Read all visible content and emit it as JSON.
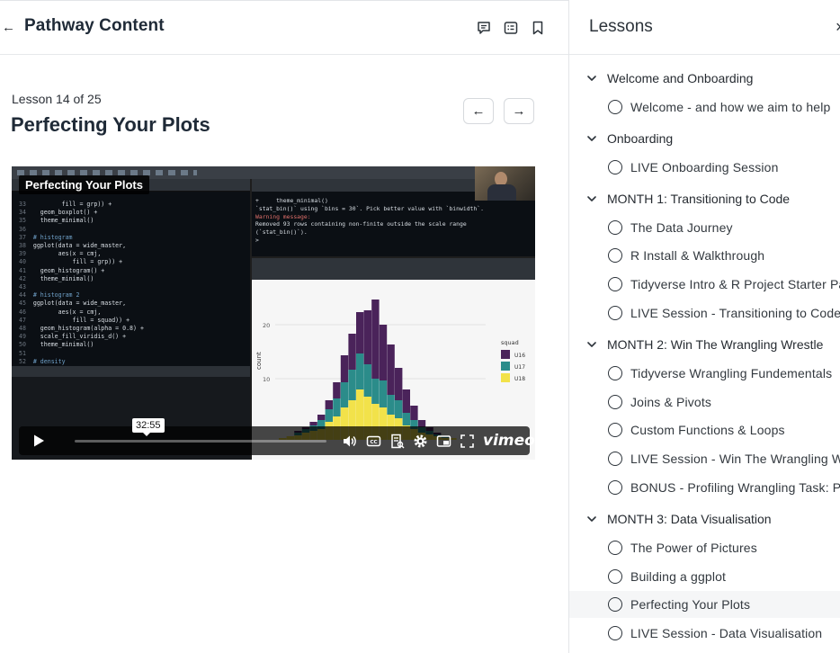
{
  "header": {
    "title": "Pathway Content",
    "icons": [
      "back-arrow-icon",
      "comment-icon",
      "notes-icon",
      "bookmark-icon"
    ]
  },
  "lesson": {
    "counter": "Lesson 14 of 25",
    "title": "Perfecting Your Plots"
  },
  "video": {
    "title_badge": "Perfecting Your Plots",
    "time": "32:55",
    "progress": 0.0,
    "brand": "vimeo",
    "code": [
      [
        "33",
        "        fill = grp)) +"
      ],
      [
        "34",
        "  geom_boxplot() +"
      ],
      [
        "35",
        "  theme_minimal()"
      ],
      [
        "36",
        ""
      ],
      [
        "37",
        "# histogram"
      ],
      [
        "38",
        "ggplot(data = wide_master,"
      ],
      [
        "39",
        "       aes(x = cmj,"
      ],
      [
        "40",
        "           fill = grp)) +"
      ],
      [
        "41",
        "  geom_histogram() +"
      ],
      [
        "42",
        "  theme_minimal()"
      ],
      [
        "43",
        ""
      ],
      [
        "44",
        "# histogram 2"
      ],
      [
        "45",
        "ggplot(data = wide_master,"
      ],
      [
        "46",
        "       aes(x = cmj,"
      ],
      [
        "47",
        "           fill = squad)) +"
      ],
      [
        "48",
        "  geom_histogram(alpha = 0.8) +"
      ],
      [
        "49",
        "  scale_fill_viridis_d() +"
      ],
      [
        "50",
        "  theme_minimal()"
      ],
      [
        "51",
        ""
      ],
      [
        "52",
        "# density"
      ]
    ],
    "console": [
      "+     theme_minimal()",
      "`stat_bin()` using `bins = 30`. Pick better value with `binwidth`.",
      "Warning message:",
      "Removed 93 rows containing non-finite outside the scale range",
      "(`stat_bin()`).",
      ">"
    ],
    "plot": {
      "legend_title": "squad",
      "legend_items": [
        "U16",
        "U17",
        "U18"
      ],
      "legend_colors": [
        "#4a235a",
        "#2b8c8a",
        "#f2e24a"
      ],
      "ylabel": "count",
      "yticks": [
        "20",
        "10"
      ]
    }
  },
  "sidebar": {
    "title": "Lessons",
    "close_label": "×",
    "sections": [
      {
        "label": "Welcome and Onboarding",
        "items": [
          "Welcome - and how we aim to help"
        ]
      },
      {
        "label": "Onboarding",
        "items": [
          "LIVE Onboarding Session"
        ]
      },
      {
        "label": "MONTH 1: Transitioning to Code",
        "items": [
          "The Data Journey",
          "R Install & Walkthrough",
          "Tidyverse Intro & R Project Starter Pack",
          "LIVE Session - Transitioning to Code"
        ]
      },
      {
        "label": "MONTH 2: Win The Wrangling Wrestle",
        "items": [
          "Tidyverse Wrangling Fundementals",
          "Joins & Pivots",
          "Custom Functions & Loops",
          "LIVE Session - Win The Wrangling Wrestle",
          "BONUS - Profiling Wrangling Task: Player"
        ]
      },
      {
        "label": "MONTH 3: Data Visualisation",
        "items": [
          "The Power of Pictures",
          "Building a ggplot",
          "Perfecting Your Plots",
          "LIVE Session - Data Visualisation"
        ]
      }
    ],
    "active_item": "Perfecting Your Plots"
  }
}
